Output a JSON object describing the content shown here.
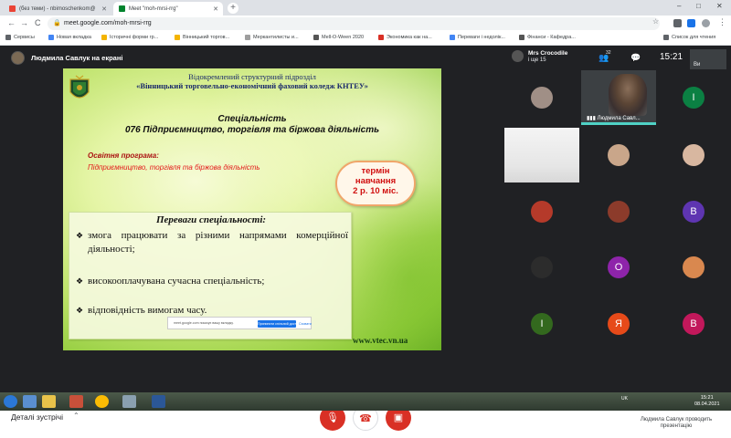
{
  "browser": {
    "tabs": [
      {
        "label": "(без теми) - nbimoschenkom@",
        "fav_color": "#ea4335",
        "active": false
      },
      {
        "label": "Meet \"moh-mrsi-rrg\"",
        "fav_color": "#00832d",
        "active": true
      }
    ],
    "new_tab_label": "+",
    "window_buttons": [
      "–",
      "□",
      "✕"
    ],
    "nav": {
      "back": "←",
      "forward": "→",
      "reload": "C"
    },
    "url": "meet.google.com/moh-mrsi-rrg",
    "bookmarks": [
      {
        "label": "Сервисы",
        "color": "#5f6368"
      },
      {
        "label": "Новая вкладка",
        "color": "#4285f4"
      },
      {
        "label": "Історичні форми гр...",
        "color": "#f4b400"
      },
      {
        "label": "Вінницький торгов...",
        "color": "#f4b400"
      },
      {
        "label": "Меркантилисты и...",
        "color": "#9e9e9e"
      },
      {
        "label": "Mell-O-Ween 2020",
        "color": "#555555"
      },
      {
        "label": "Экономика как на...",
        "color": "#d93025"
      },
      {
        "label": "Переваги і недолік...",
        "color": "#4285f4"
      },
      {
        "label": "Фінанси - Кафедра...",
        "color": "#555555"
      }
    ],
    "reading_list": "Список для чтения"
  },
  "meet": {
    "presenter_header": "Людмила Савлук на екрані",
    "room": {
      "name": "Mrs Crocodile",
      "others": "і ще 15"
    },
    "people_count": "32",
    "clock": "15:21",
    "self_label": "Ви",
    "tiles": [
      {
        "type": "avatar",
        "initial": "",
        "color": "#a08f86"
      },
      {
        "type": "speaker",
        "label": "Людмила Савл..."
      },
      {
        "type": "avatar",
        "initial": "I",
        "color": "#0b8043"
      },
      {
        "type": "wall"
      },
      {
        "type": "avatar",
        "initial": "",
        "color": "#c9a68a"
      },
      {
        "type": "avatar",
        "initial": "",
        "color": "#d8b7a0"
      },
      {
        "type": "avatar",
        "initial": "",
        "color": "#b53a2a"
      },
      {
        "type": "avatar",
        "initial": "",
        "color": "#8c3b2b"
      },
      {
        "type": "avatar",
        "initial": "В",
        "color": "#5e35b1"
      },
      {
        "type": "avatar",
        "initial": "",
        "color": "#2c2c2c"
      },
      {
        "type": "avatar",
        "initial": "O",
        "color": "#8e24aa"
      },
      {
        "type": "avatar",
        "initial": "",
        "color": "#d9884f"
      },
      {
        "type": "avatar",
        "initial": "I",
        "color": "#33691e"
      },
      {
        "type": "avatar",
        "initial": "Я",
        "color": "#e64a19"
      },
      {
        "type": "avatar",
        "initial": "В",
        "color": "#c2185b"
      }
    ],
    "details_label": "Деталі зустрічі",
    "presenting_text": "Людмила Савлук проводить презентацію"
  },
  "slide": {
    "org_line1": "Відокремлений структурний підрозділ",
    "org_line2": "«Вінницький торговельно-економічний фаховий коледж КНТЕУ»",
    "spec_heading": "Спеціальність",
    "spec_name": "076 Підприємництво, торгівля та біржова діяльність",
    "program_heading": "Освітня програма:",
    "program_name": "Підприємництво, торгівля та біржова діяльність",
    "term_line1": "термін",
    "term_line2": "навчання",
    "term_line3": "2 р. 10 міс.",
    "advantages_title": "Переваги спеціальності:",
    "advantages": [
      "змога працювати за різними напрямами комерційної діяльності;",
      "високооплачувана сучасна спеціальність;",
      "відповідність вимогам часу."
    ],
    "share_notice": "meet.google.com показує вашу вкладку.",
    "share_stop": "Припинити спільний доступ",
    "share_hide": "Сховати",
    "url": "www.vtec.vn.ua"
  },
  "taskbar": {
    "lang": "UK",
    "time": "15:21",
    "date": "08.04.2021"
  },
  "colors": {
    "meet_bg": "#202124",
    "accent_red": "#d93025",
    "speaker_bar": "#4fd1c5"
  }
}
